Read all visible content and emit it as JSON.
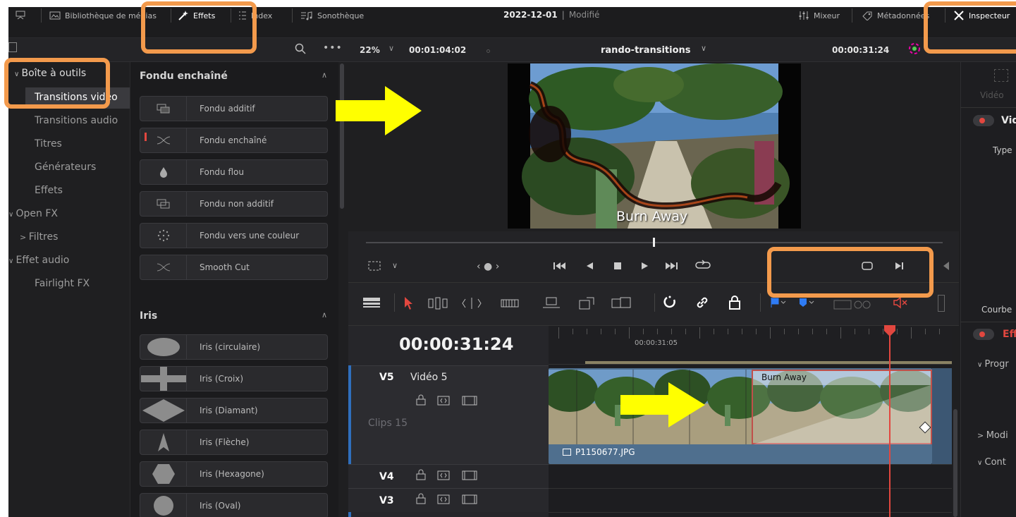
{
  "topbar": {
    "media_library": "Bibliothèque de médias",
    "effects": "Effets",
    "index": "Index",
    "sound_library": "Sonothèque",
    "project_date": "2022-12-01",
    "modified": "Modifié",
    "mixer": "Mixeur",
    "metadata": "Métadonnées",
    "inspector": "Inspecteur"
  },
  "viewer": {
    "zoom": "22%",
    "source_timecode": "00:01:04:02",
    "timeline_name": "rando-transitions",
    "record_timecode": "00:00:31:24",
    "overlay_caption": "Burn Away"
  },
  "toolbox": {
    "root": "Boîte à outils",
    "items": [
      "Transitions vidéo",
      "Transitions audio",
      "Titres",
      "Générateurs",
      "Effets"
    ],
    "open_fx": "Open FX",
    "filters": "Filtres",
    "audio_fx": "Effet audio",
    "fairlight": "Fairlight FX"
  },
  "effects_panel": {
    "dissolve_title": "Fondu enchaîné",
    "dissolves": [
      "Fondu additif",
      "Fondu enchaîné",
      "Fondu flou",
      "Fondu non additif",
      "Fondu vers une couleur",
      "Smooth Cut"
    ],
    "iris_title": "Iris",
    "iris": [
      "Iris (circulaire)",
      "Iris (Croix)",
      "Iris (Diamant)",
      "Iris (Flèche)",
      "Iris (Hexagone)",
      "Iris (Oval)"
    ]
  },
  "timeline": {
    "timecode": "00:00:31:24",
    "ruler_mark": "00:00:31:05",
    "tracks": [
      {
        "id": "V5",
        "name": "Vidéo 5",
        "clips": "Clips 15"
      },
      {
        "id": "V4"
      },
      {
        "id": "V3"
      }
    ],
    "clip_name": "P1150677.JPG",
    "transition_label": "Burn Away"
  },
  "inspector_panel": {
    "video_tab": "Vidéo",
    "video_section": "Vid",
    "type_label": "Type",
    "curve_label": "Courbe",
    "effect_section": "Eff",
    "progress": "Progr",
    "modifier": "Modi",
    "contour": "Cont"
  },
  "colors": {
    "accent_orange": "#f39a4c",
    "arrow_yellow": "#ffff00",
    "playhead_red": "#e2473f",
    "clip_blue": "#4f6f8e"
  }
}
